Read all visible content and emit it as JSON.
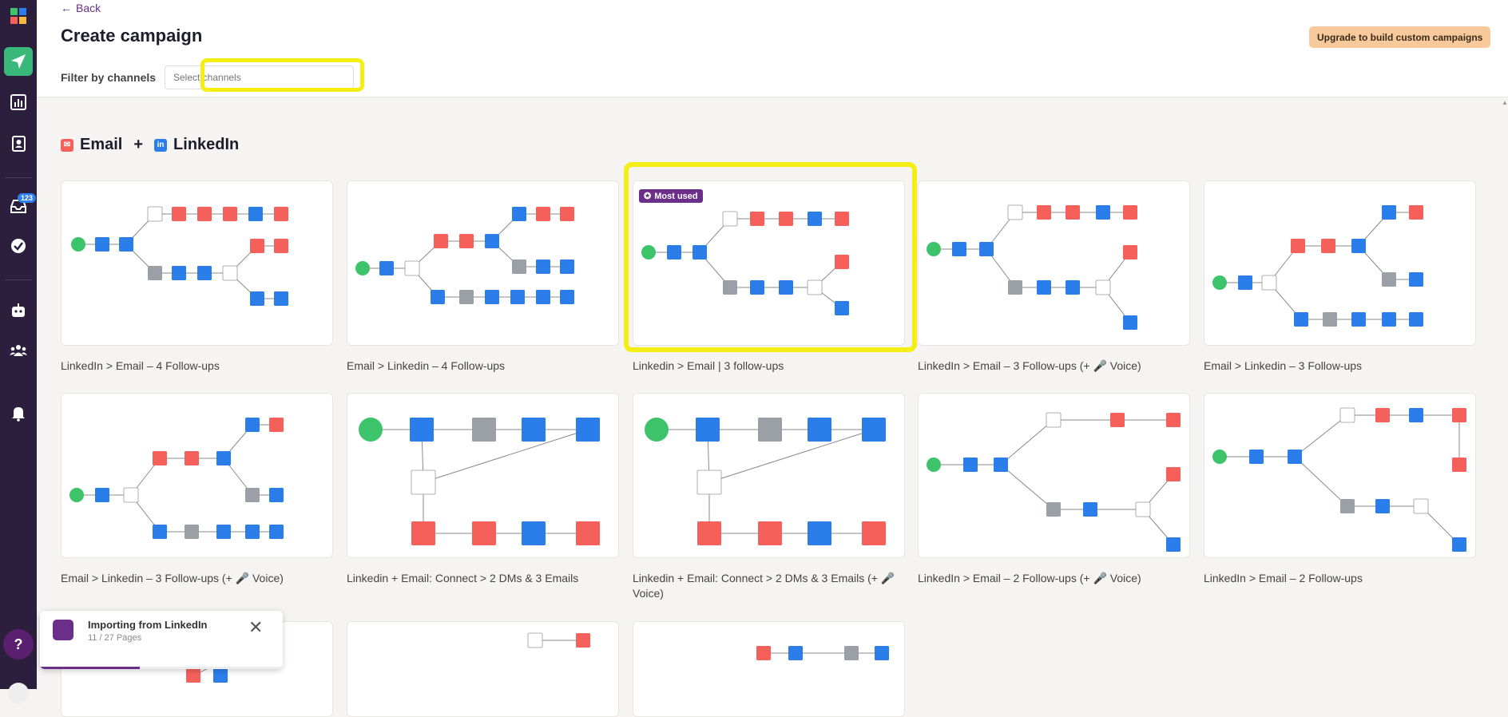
{
  "app": {
    "back_label": "Back",
    "title": "Create campaign",
    "upgrade_label": "Upgrade to build custom campaigns",
    "filter_label": "Filter by channels",
    "filter_placeholder": "Select channels"
  },
  "sidebar": {
    "badge": "123",
    "help": "?",
    "icons": [
      "logo-icon",
      "send-icon",
      "analytics-icon",
      "contacts-icon",
      "inbox-icon",
      "tasks-icon",
      "bot-icon",
      "team-icon",
      "bell-icon"
    ]
  },
  "section": {
    "left": "Email",
    "plus": "+",
    "right": "LinkedIn"
  },
  "most_used": "Most used",
  "colors": {
    "email": "#f5605b",
    "linkedin": "#2b7de9",
    "wait": "#9aa0a6",
    "start": "#3dc46b",
    "accent": "#6b2f8a",
    "highlight": "#f5ee13"
  },
  "cards": [
    {
      "label": "LinkedIn > Email – 4 Follow-ups"
    },
    {
      "label": "Email > Linkedin – 4 Follow-ups"
    },
    {
      "label": "Linkedin > Email | 3 follow-ups"
    },
    {
      "label": "LinkedIn > Email – 3 Follow-ups (+ 🎤 Voice)"
    },
    {
      "label": "Email > Linkedin – 3 Follow-ups"
    },
    {
      "label": "Email > Linkedin – 3 Follow-ups (+ 🎤 Voice)"
    },
    {
      "label": "Linkedin + Email: Connect > 2 DMs & 3 Emails"
    },
    {
      "label": "Linkedin + Email: Connect > 2 DMs & 3 Emails (+ 🎤 Voice)"
    },
    {
      "label": "LinkedIn > Email – 2 Follow-ups (+ 🎤 Voice)"
    },
    {
      "label": "LinkedIn > Email – 2 Follow-ups"
    },
    {
      "label": ""
    },
    {
      "label": ""
    },
    {
      "label": ""
    }
  ],
  "toast": {
    "title": "Importing from LinkedIn",
    "subtitle": "11 / 27 Pages",
    "progress": 0.41
  }
}
